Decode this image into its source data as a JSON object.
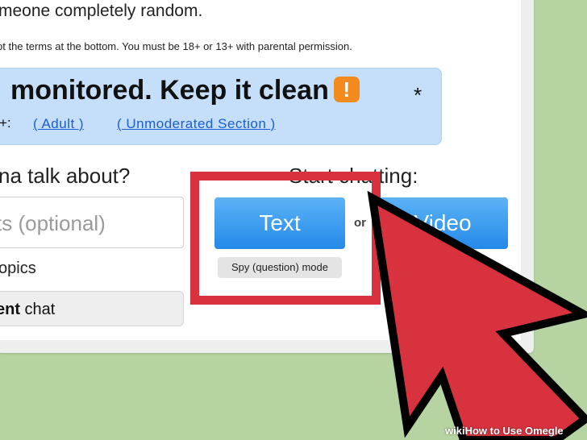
{
  "intro": {
    "text": "meone completely random.",
    "terms": "pt the terms at the bottom. You must be 18+ or 13+ with parental permission."
  },
  "banner": {
    "text": "monitored. Keep it clean",
    "warning_icon": "exclamation-icon",
    "warning_glyph": "!",
    "asterisk": "*",
    "age_prefix": "+:",
    "adult_link": "( Adult )",
    "unmoderated_link": "( Unmoderated Section )",
    "color": "#c5def9"
  },
  "talk": {
    "heading": "na talk about?",
    "interests_placeholder": "ts (optional)",
    "topics_label": "opics",
    "student_bold": "ent",
    "student_rest": " chat"
  },
  "start": {
    "heading": "Start chatting:",
    "text_button": "Text",
    "or_label": "or",
    "video_button": "Video",
    "spy_button": "Spy (question) mode",
    "button_color": "#2489e8"
  },
  "annotation": {
    "highlight_color": "#d8323e",
    "arrow_icon": "pointer-arrow-icon"
  },
  "watermark": {
    "wiki": "wiki",
    "title": "How to Use Omegle"
  }
}
